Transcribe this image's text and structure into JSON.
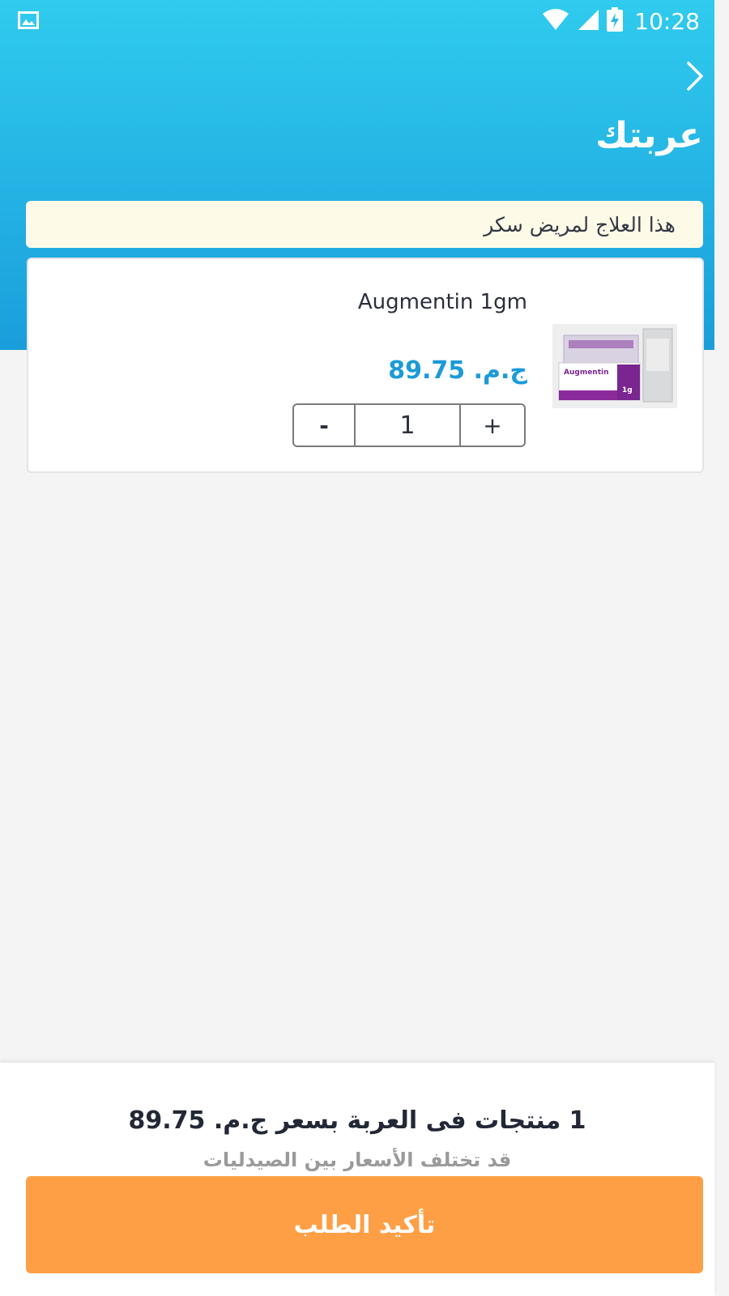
{
  "status_bar": {
    "time": "10:28",
    "icons": [
      "gallery-icon",
      "wifi-icon",
      "signal-icon",
      "battery-charging-icon"
    ]
  },
  "header": {
    "back_icon": "chevron-right-icon",
    "title": "عربتك"
  },
  "cart": {
    "note": "هذا العلاج لمريض سكر",
    "items": [
      {
        "name": "Augmentin 1gm",
        "price": "ج.م. 89.75",
        "quantity": "1",
        "minus_label": "-",
        "plus_label": "+",
        "image": {
          "brand_text": "Augmentin",
          "strength_text": "1g"
        }
      }
    ]
  },
  "footer": {
    "summary": "1 منتجات فى العربة بسعر ج.م. 89.75",
    "disclaimer": "قد تختلف الأسعار بين الصيدليات",
    "confirm_label": "تأكيد الطلب"
  },
  "colors": {
    "header_gradient_top": "#30cbee",
    "header_gradient_bottom": "#1a9edb",
    "price": "#1b9bd8",
    "confirm_button": "#ff9f45",
    "note_background": "#fdfbe8",
    "page_background": "#f4f4f4"
  }
}
